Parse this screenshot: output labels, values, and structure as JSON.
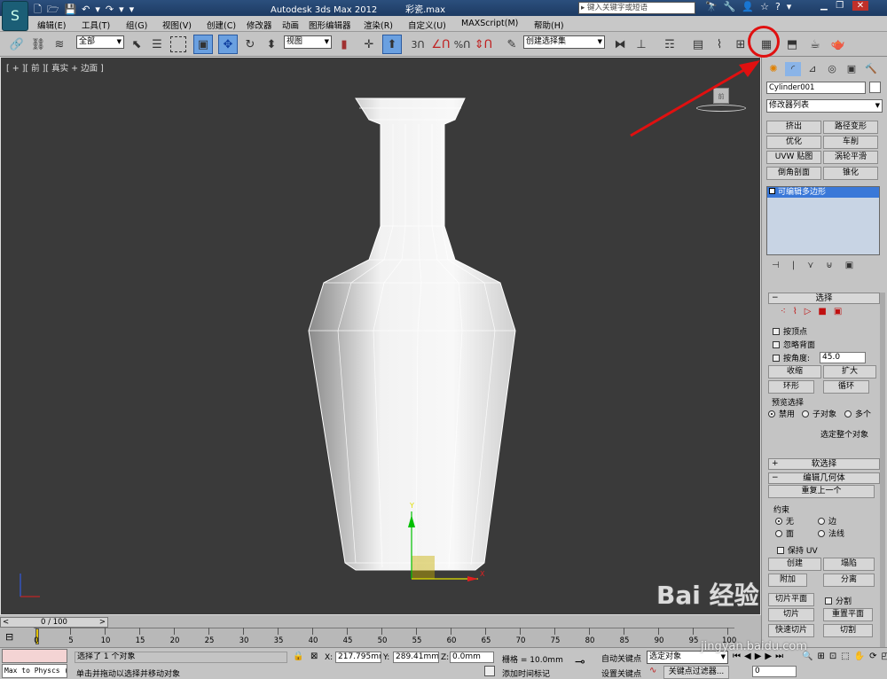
{
  "titlebar": {
    "app_title": "Autodesk 3ds Max 2012",
    "file_name": "彩瓷.max",
    "search_placeholder": "键入关键字或短语"
  },
  "menu": [
    "编辑(E)",
    "工具(T)",
    "组(G)",
    "视图(V)",
    "创建(C)",
    "修改器",
    "动画",
    "图形编辑器",
    "渲染(R)",
    "自定义(U)",
    "MAXScript(M)",
    "帮助(H)"
  ],
  "toolbar": {
    "selection_filter": "全部",
    "ref_coord": "视图",
    "snap_angle_label": "3",
    "named_selection": "创建选择集",
    "percent_label": "%"
  },
  "viewport": {
    "label": "[ + ][ 前 ][ 真实 + 边面 ]",
    "viewcube_label": "前"
  },
  "panel": {
    "object_name": "Cylinder001",
    "modifier_list": "修改器列表",
    "mod_buttons": [
      "挤出",
      "路径变形",
      "优化",
      "车削",
      "UVW 贴图",
      "涡轮平滑",
      "倒角剖面",
      "锥化"
    ],
    "stack_item": "可编辑多边形",
    "selection": {
      "title": "选择",
      "by_vertex": "按顶点",
      "ignore_backfacing": "忽略背面",
      "by_angle": "按角度:",
      "angle_value": "45.0",
      "shrink": "收缩",
      "grow": "扩大",
      "ring": "环形",
      "loop": "循环",
      "preview_title": "预览选择",
      "preview_off": "禁用",
      "preview_sub": "子对象",
      "preview_multi": "多个",
      "whole_object": "选定整个对象"
    },
    "soft_selection": "软选择",
    "edit_geometry": {
      "title": "编辑几何体",
      "repeat_last": "重复上一个",
      "constraints": "约束",
      "none": "无",
      "edge": "边",
      "face": "面",
      "normal": "法线",
      "preserve_uv": "保持 UV",
      "create": "创建",
      "collapse": "塌陷",
      "attach": "附加",
      "detach": "分离",
      "slice_plane": "切片平面",
      "split": "分割",
      "slice": "切片",
      "reset_plane": "重置平面",
      "quickslice": "快速切片",
      "cut": "切割"
    }
  },
  "timeline": {
    "frame": "0 / 100",
    "ticks": [
      "0",
      "5",
      "10",
      "15",
      "20",
      "25",
      "30",
      "35",
      "40",
      "45",
      "50",
      "55",
      "60",
      "65",
      "70",
      "75",
      "80",
      "85",
      "90",
      "95",
      "100"
    ]
  },
  "status": {
    "script_text": "Max to Physcs (",
    "selected": "选择了 1 个对象",
    "prompt": "单击并拖动以选择并移动对象",
    "x_label": "X:",
    "x_value": "217.795mm",
    "y_label": "Y:",
    "y_value": "289.41mm",
    "z_label": "Z:",
    "z_value": "0.0mm",
    "grid": "栅格 = 10.0mm",
    "add_time_tag": "添加时间标记",
    "auto_key": "自动关键点",
    "set_key": "设置关键点",
    "key_mode": "选定对象",
    "key_filter": "关键点过滤器...",
    "frame_field": "0"
  },
  "watermark": {
    "logo": "Bai 经验",
    "url": "jingyan.baidu.com"
  },
  "colors": {
    "viewport_bg": "#3a3a3a",
    "annotation_red": "#e01010",
    "stack_selected": "#3a78d8"
  }
}
